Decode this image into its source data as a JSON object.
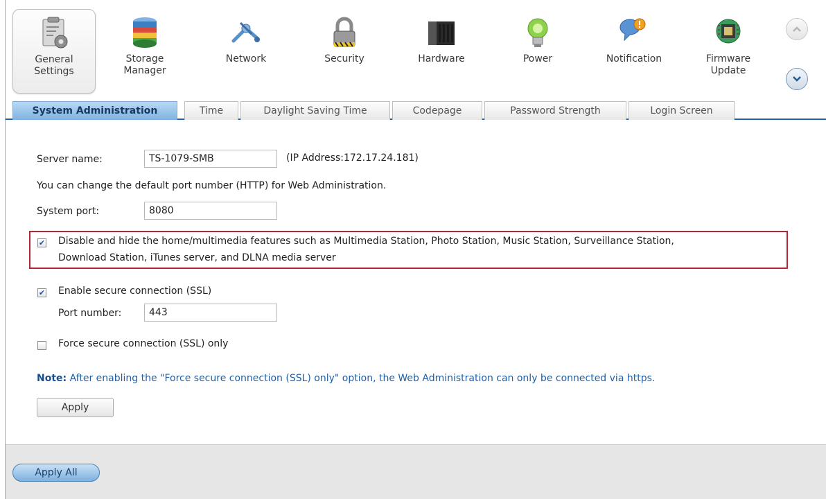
{
  "toolbar": {
    "items": [
      {
        "label_line1": "General",
        "label_line2": "Settings",
        "icon": "general-settings-icon"
      },
      {
        "label_line1": "Storage",
        "label_line2": "Manager",
        "icon": "storage-manager-icon"
      },
      {
        "label_line1": "Network",
        "label_line2": "",
        "icon": "network-icon"
      },
      {
        "label_line1": "Security",
        "label_line2": "",
        "icon": "lock-icon"
      },
      {
        "label_line1": "Hardware",
        "label_line2": "",
        "icon": "hardware-icon"
      },
      {
        "label_line1": "Power",
        "label_line2": "",
        "icon": "power-bulb-icon"
      },
      {
        "label_line1": "Notification",
        "label_line2": "",
        "icon": "notification-icon"
      },
      {
        "label_line1": "Firmware",
        "label_line2": "Update",
        "icon": "firmware-update-icon"
      }
    ]
  },
  "tabs": [
    "System Administration",
    "Time",
    "Daylight Saving Time",
    "Codepage",
    "Password Strength",
    "Login Screen"
  ],
  "form": {
    "server_name_label": "Server name:",
    "server_name_value": "TS-1079-SMB",
    "ip_address": "(IP Address:172.17.24.181)",
    "port_info": "You can change the default port number (HTTP) for Web Administration.",
    "system_port_label": "System port:",
    "system_port_value": "8080",
    "disable_multimedia_line1": "Disable and hide the home/multimedia features such as Multimedia Station, Photo Station, Music Station, Surveillance Station,",
    "disable_multimedia_line2": "Download Station, iTunes server, and DLNA media server",
    "disable_multimedia_checked": true,
    "ssl_label": "Enable secure connection (SSL)",
    "ssl_checked": true,
    "port_number_label": "Port number:",
    "port_number_value": "443",
    "force_ssl_label": "Force secure connection (SSL) only",
    "force_ssl_checked": false,
    "note_prefix": "Note:",
    "note_text": " After enabling the \"Force secure connection (SSL) only\" option, the Web Administration can only be connected via https.",
    "apply_label": "Apply"
  },
  "footer": {
    "apply_all_label": "Apply All"
  },
  "colors": {
    "accent": "#1f63a5",
    "highlight_border": "#b3263a",
    "note_text": "#1f5fa6"
  }
}
